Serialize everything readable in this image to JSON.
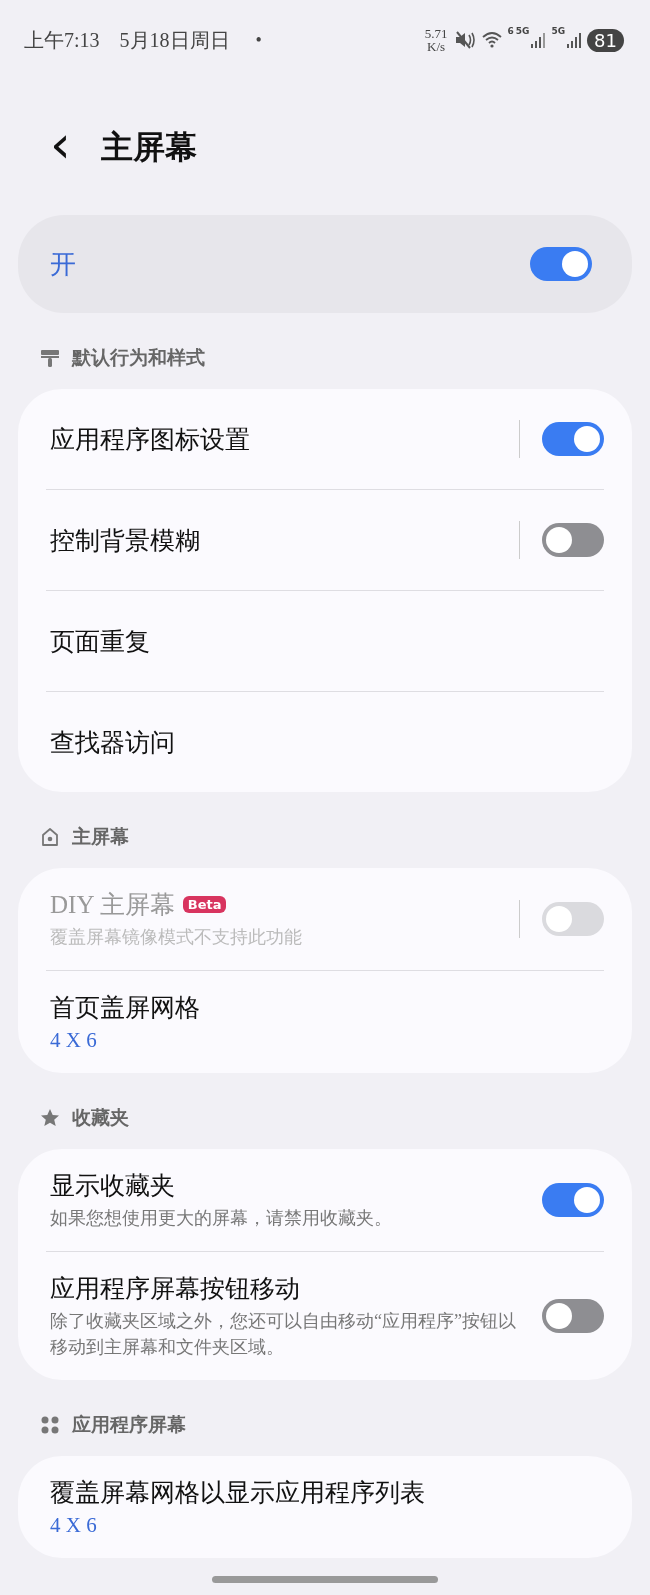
{
  "status_bar": {
    "time": "上午7:13",
    "date": "5月18日周日",
    "dot": "•",
    "speed": "5.71",
    "speed_unit": "K/s",
    "wifi_badge": "6",
    "signal_1": "5G",
    "signal_2": "5G",
    "battery": "81"
  },
  "header": {
    "back": "‹",
    "title": "主屏幕"
  },
  "master": {
    "label": "开",
    "on": true
  },
  "sections": [
    {
      "title": "默认行为和样式",
      "rows": [
        {
          "kind": "toggle",
          "title": "应用程序图标设置",
          "on": true,
          "separator": true
        },
        {
          "kind": "toggle",
          "title": "控制背景模糊",
          "on": false,
          "separator": true
        },
        {
          "kind": "nav",
          "title": "页面重复"
        },
        {
          "kind": "nav",
          "title": "查找器访问"
        }
      ]
    },
    {
      "title": "主屏幕",
      "rows": [
        {
          "kind": "toggle",
          "title": "DIY 主屏幕",
          "badge": "Beta",
          "subtitle": "覆盖屏幕镜像模式不支持此功能",
          "on": false,
          "disabled": true,
          "separator": true
        },
        {
          "kind": "nav",
          "title": "首页盖屏网格",
          "value": "4 X 6"
        }
      ]
    },
    {
      "title": "收藏夹",
      "rows": [
        {
          "kind": "toggle",
          "title": "显示收藏夹",
          "subtitle": "如果您想使用更大的屏幕，请禁用收藏夹。",
          "on": true
        },
        {
          "kind": "toggle",
          "title": "应用程序屏幕按钮移动",
          "subtitle": "除了收藏夹区域之外，您还可以自由移动“应用程序”按钮以移动到主屏幕和文件夹区域。",
          "on": false
        }
      ]
    },
    {
      "title": "应用程序屏幕",
      "rows": [
        {
          "kind": "nav",
          "title": "覆盖屏幕网格以显示应用程序列表",
          "value": "4 X 6"
        }
      ]
    }
  ]
}
